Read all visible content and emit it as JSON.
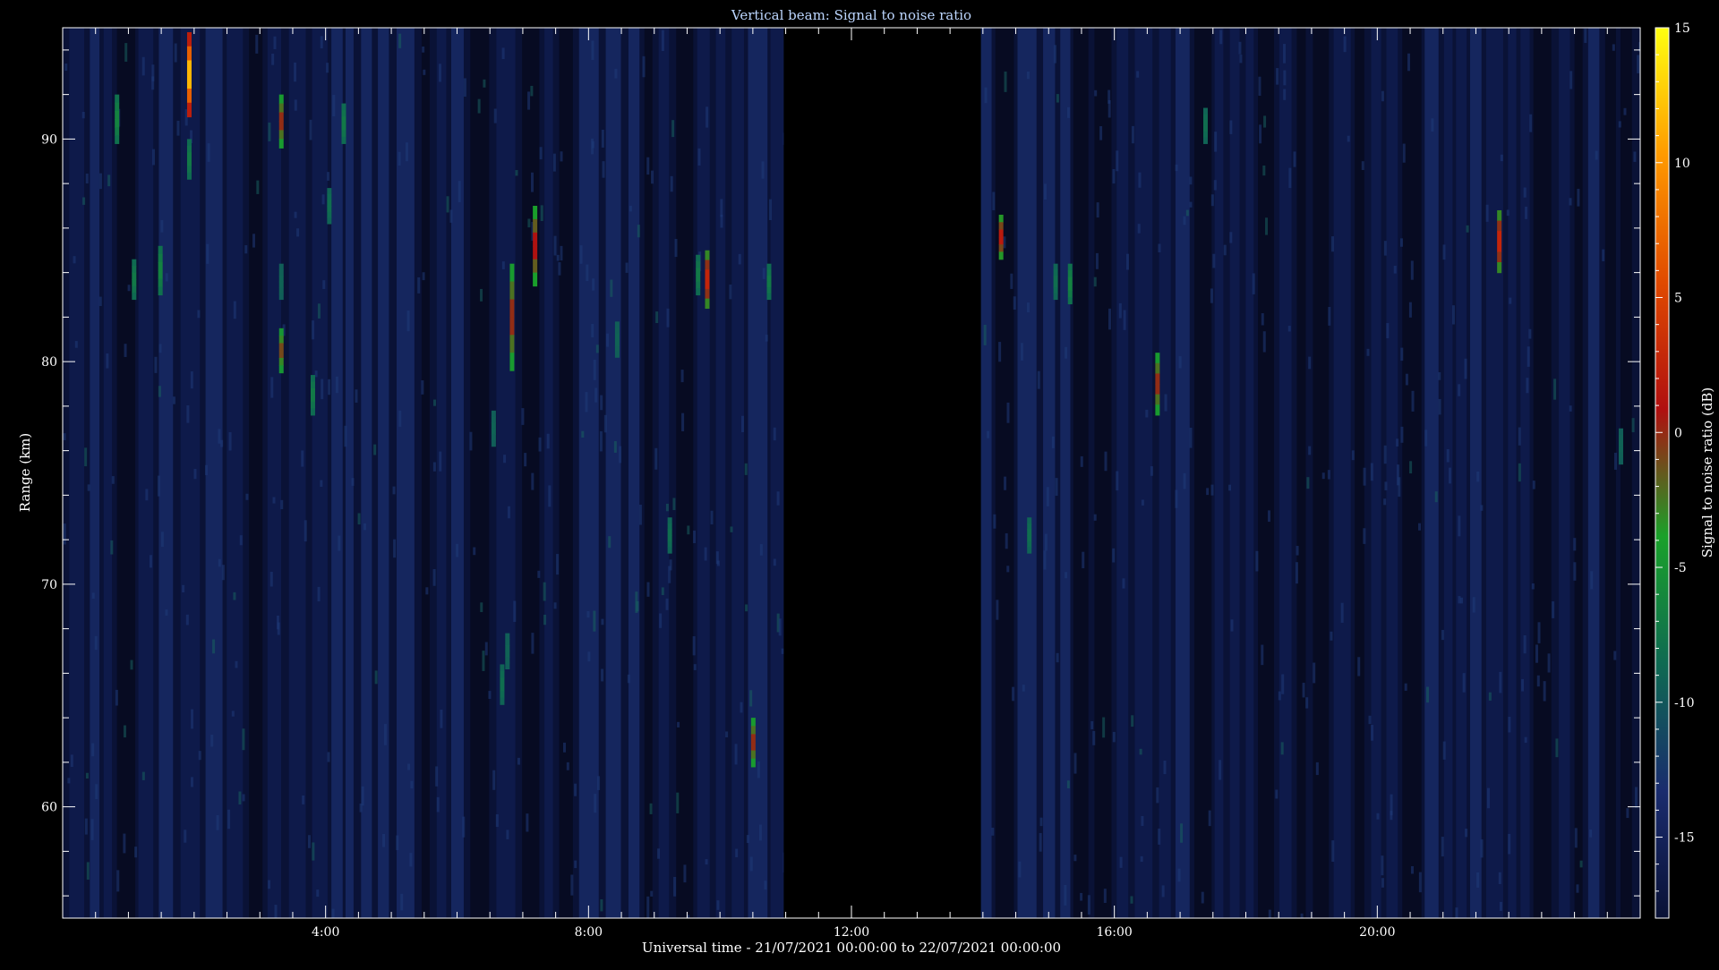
{
  "chart_data": {
    "type": "heatmap",
    "title": "Vertical beam: Signal to noise ratio",
    "xlabel": "Universal time - 21/07/2021 00:00:00 to 22/07/2021 00:00:00",
    "ylabel": "Range (km)",
    "x_unit": "hours UT",
    "xlim": [
      0,
      24
    ],
    "ylim": [
      55,
      95
    ],
    "x_ticks": [
      {
        "value": 4,
        "label": "4:00"
      },
      {
        "value": 8,
        "label": "8:00"
      },
      {
        "value": 12,
        "label": "12:00"
      },
      {
        "value": 16,
        "label": "16:00"
      },
      {
        "value": 20,
        "label": "20:00"
      }
    ],
    "y_ticks": [
      {
        "value": 60,
        "label": "60"
      },
      {
        "value": 70,
        "label": "70"
      },
      {
        "value": 80,
        "label": "80"
      },
      {
        "value": 90,
        "label": "90"
      }
    ],
    "data_gap": {
      "start": 10.97,
      "end": 13.97
    },
    "background_snr_db": -16,
    "events": [
      {
        "t": 0.82,
        "r0": 89.8,
        "r1": 92.0,
        "peak": -6
      },
      {
        "t": 1.08,
        "r0": 82.8,
        "r1": 84.6,
        "peak": -7
      },
      {
        "t": 1.48,
        "r0": 83.0,
        "r1": 85.2,
        "peak": -6
      },
      {
        "t": 1.92,
        "r0": 91.0,
        "r1": 94.8,
        "peak": 14
      },
      {
        "t": 1.92,
        "r0": 88.2,
        "r1": 90.0,
        "peak": -7
      },
      {
        "t": 3.32,
        "r0": 89.6,
        "r1": 92.0,
        "peak": 1
      },
      {
        "t": 3.32,
        "r0": 79.5,
        "r1": 81.5,
        "peak": 0
      },
      {
        "t": 3.32,
        "r0": 82.8,
        "r1": 84.4,
        "peak": -9
      },
      {
        "t": 3.8,
        "r0": 77.6,
        "r1": 79.4,
        "peak": -7
      },
      {
        "t": 4.05,
        "r0": 86.2,
        "r1": 87.8,
        "peak": -8
      },
      {
        "t": 4.27,
        "r0": 89.8,
        "r1": 91.6,
        "peak": -7
      },
      {
        "t": 6.55,
        "r0": 76.2,
        "r1": 77.8,
        "peak": -9
      },
      {
        "t": 6.68,
        "r0": 64.6,
        "r1": 66.4,
        "peak": -8
      },
      {
        "t": 6.76,
        "r0": 66.2,
        "r1": 67.8,
        "peak": -9
      },
      {
        "t": 6.83,
        "r0": 79.6,
        "r1": 84.4,
        "peak": 1
      },
      {
        "t": 7.18,
        "r0": 83.4,
        "r1": 87.0,
        "peak": 2
      },
      {
        "t": 8.43,
        "r0": 80.2,
        "r1": 81.8,
        "peak": -9
      },
      {
        "t": 9.23,
        "r0": 71.4,
        "r1": 73.0,
        "peak": -8
      },
      {
        "t": 9.66,
        "r0": 83.0,
        "r1": 84.8,
        "peak": -7
      },
      {
        "t": 9.8,
        "r0": 82.4,
        "r1": 85.0,
        "peak": 4
      },
      {
        "t": 10.5,
        "r0": 61.8,
        "r1": 64.0,
        "peak": 1
      },
      {
        "t": 10.74,
        "r0": 82.8,
        "r1": 84.4,
        "peak": -7
      },
      {
        "t": 14.27,
        "r0": 84.6,
        "r1": 86.6,
        "peak": 3
      },
      {
        "t": 14.7,
        "r0": 71.4,
        "r1": 73.0,
        "peak": -8
      },
      {
        "t": 15.1,
        "r0": 82.8,
        "r1": 84.4,
        "peak": -8
      },
      {
        "t": 15.32,
        "r0": 82.6,
        "r1": 84.4,
        "peak": -6
      },
      {
        "t": 16.65,
        "r0": 77.6,
        "r1": 80.4,
        "peak": 1
      },
      {
        "t": 17.38,
        "r0": 89.8,
        "r1": 91.4,
        "peak": -8
      },
      {
        "t": 21.85,
        "r0": 84.0,
        "r1": 86.8,
        "peak": 4
      },
      {
        "t": 23.7,
        "r0": 75.4,
        "r1": 77.0,
        "peak": -9
      }
    ]
  },
  "colorbar": {
    "label": "Signal to noise ratio (dB)",
    "min": -18,
    "max": 15,
    "ticks": [
      {
        "value": 15,
        "label": "15"
      },
      {
        "value": 10,
        "label": "10"
      },
      {
        "value": 5,
        "label": "5"
      },
      {
        "value": 0,
        "label": "0"
      },
      {
        "value": -5,
        "label": "-5"
      },
      {
        "value": -10,
        "label": "-10"
      },
      {
        "value": -15,
        "label": "-15"
      }
    ],
    "colors": [
      "#0a1236",
      "#1a2c6e",
      "#0f6a52",
      "#1aa12a",
      "#b01010",
      "#e04a00",
      "#ff9a00",
      "#ffff10"
    ]
  },
  "colors": {
    "background": "#000000",
    "axes": "#ffffff",
    "title": "#bcd6ff",
    "text": "#ffffff"
  }
}
